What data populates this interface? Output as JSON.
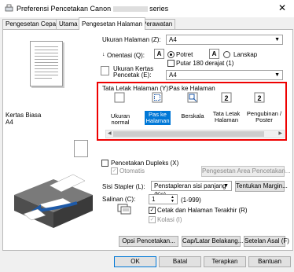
{
  "window": {
    "title": "Preferensi Pencetakan Canon",
    "title_suffix": "series",
    "close": "✕"
  },
  "tabs": [
    "Pengesetan Cepat",
    "Utama",
    "Pengesetan Halaman",
    "Perawatan"
  ],
  "preview": {
    "media": "Kertas Biasa",
    "size": "A4"
  },
  "page_size": {
    "label": "Ukuran Halaman (Z):",
    "value": "A4"
  },
  "orientation": {
    "label": "Onentasi (Q):",
    "portrait": "Potret",
    "landscape": "Lanskap",
    "selected": "portrait",
    "rotate_label": "Putar 180 derajat (1)"
  },
  "printer_paper": {
    "label": "Ukuran Kertas Pencetak (E):",
    "value": "A4"
  },
  "page_layout": {
    "label": "Tata Letak Halaman (Y):",
    "current": "Pas ke Halaman",
    "options": [
      "Ukuran normal",
      "Pas ke Halaman",
      "Berskala",
      "Tata Letak Halaman",
      "Pengubinan / Poster"
    ],
    "selected_index": 1
  },
  "duplex": {
    "label": "Pencetakan Dupleks (X)",
    "auto_label": "Otomatis",
    "area_button": "Pengesetan Area Pencetakan..."
  },
  "stapling": {
    "label": "Sisi Stapler (L):",
    "value": "Penstapleran sisi panjang (Kn)",
    "margin_button": "Tentukan Margin..."
  },
  "copies": {
    "label": "Salinan (C):",
    "value": "1",
    "range": "(1-999)",
    "last_page_label": "Cetak dan Halaman Terakhir (R)",
    "collate_label": "Kolasi (I)"
  },
  "options_buttons": [
    "Opsi Pencetakan...",
    "Cap/Latar Belakang...",
    "Setelan Asal (F)"
  ],
  "dialog_buttons": [
    "OK",
    "Batal",
    "Terapkan",
    "Bantuan"
  ],
  "colors": {
    "red_highlight": "#e00000",
    "selection": "#0078d7",
    "accent": "#1e5aa8"
  }
}
